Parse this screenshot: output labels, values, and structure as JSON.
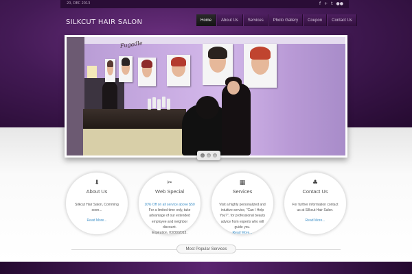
{
  "topbar": {
    "date": "20, DEC 2013",
    "social_icons": [
      "facebook-icon",
      "plus-icon",
      "twitter-icon",
      "flickr-icon"
    ],
    "social_glyphs": [
      "f",
      "+",
      "t",
      "●●"
    ]
  },
  "header": {
    "logo": "SILKCUT HAIR SALON"
  },
  "nav": {
    "items": [
      {
        "label": "Home",
        "active": true
      },
      {
        "label": "About Us"
      },
      {
        "label": "Services"
      },
      {
        "label": "Photo Gallery"
      },
      {
        "label": "Coupon"
      },
      {
        "label": "Contact Us"
      }
    ]
  },
  "slider": {
    "sign_text": "Fugadle",
    "dots": 3,
    "active_dot": 0
  },
  "features": [
    {
      "icon": "arrow-down-icon",
      "glyph": "⬇",
      "title": "About Us",
      "lines": [
        "Silkcut Hair Salon, Comming",
        "soon..."
      ],
      "more": "Read More..."
    },
    {
      "icon": "web-special-icon",
      "glyph": "✂",
      "title": "Web Special",
      "highlight": "10% Off on all service above $50",
      "lines": [
        "For a limited time only, take",
        "advantage of our extended",
        "employee and neighbor",
        "discount.",
        "Expiration, 03/30/2013."
      ]
    },
    {
      "icon": "calendar-icon",
      "glyph": "▦",
      "title": "Services",
      "lines": [
        "Visit a highly personalized and",
        "intuitive service, \"Can I Help",
        "You?\", for professional beauty",
        "advice from experts who will",
        "guide you."
      ],
      "more": "Read More..."
    },
    {
      "icon": "contact-icon",
      "glyph": "♣",
      "title": "Contact Us",
      "lines": [
        "For further information contact",
        "us at Silkcut Hair Salon."
      ],
      "more": "Read More..."
    }
  ],
  "popular": {
    "label": "Most Popular Services"
  },
  "colors": {
    "accent_link": "#3c8fc7",
    "header_purple": "#431a55",
    "nav_active": "#1a1a1a"
  }
}
